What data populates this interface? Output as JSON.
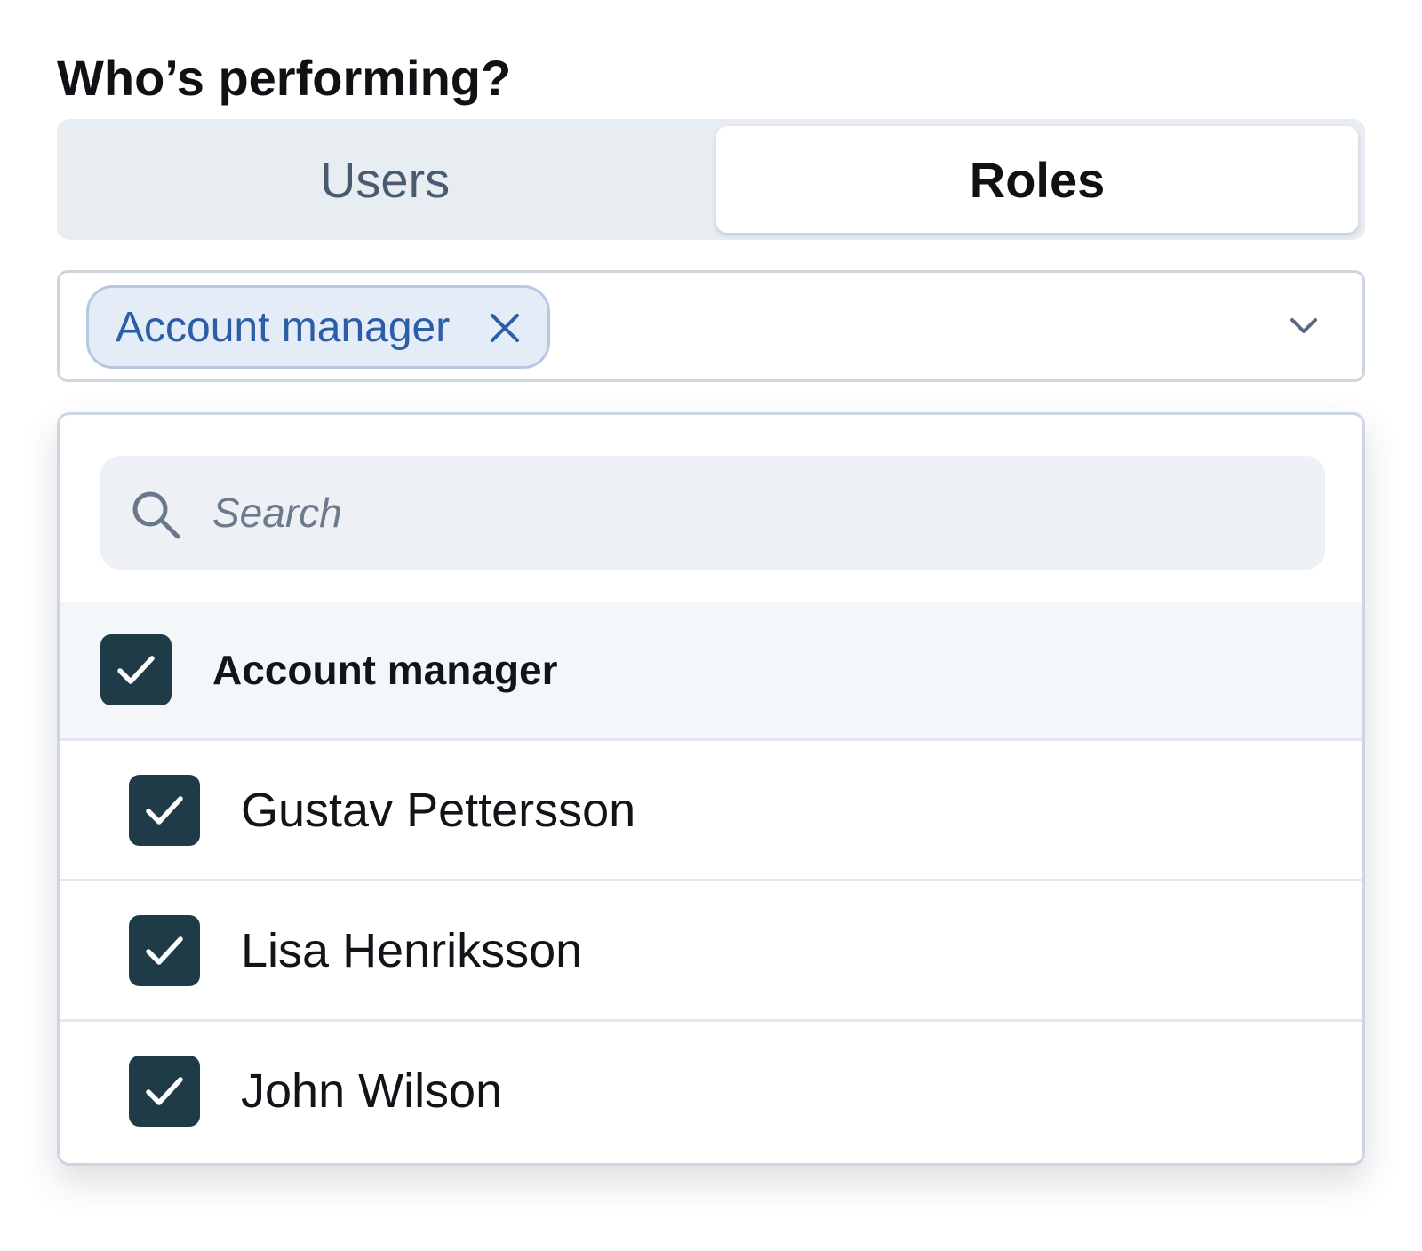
{
  "heading": "Who’s performing?",
  "tabs": {
    "users_label": "Users",
    "roles_label": "Roles",
    "selected": "Roles"
  },
  "select": {
    "chips": [
      {
        "label": "Account manager"
      }
    ]
  },
  "dropdown": {
    "search_placeholder": "Search",
    "group": {
      "label": "Account manager",
      "checked": true
    },
    "members": [
      {
        "label": "Gustav Pettersson",
        "checked": true
      },
      {
        "label": "Lisa Henriksson",
        "checked": true
      },
      {
        "label": "John Wilson",
        "checked": true
      }
    ]
  },
  "colors": {
    "checkbox_fill": "#1f3b47",
    "chip_text": "#2b5ea6",
    "chip_background": "#e4ecf7",
    "segmented_background": "#e8edf2"
  }
}
